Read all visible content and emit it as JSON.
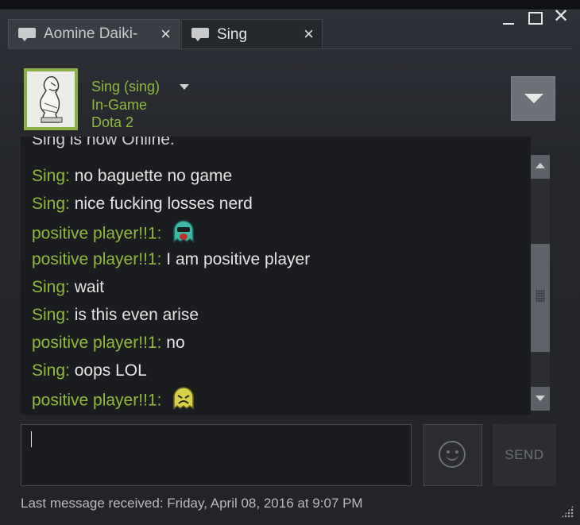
{
  "tabs": [
    {
      "label": "Aomine Daiki-",
      "close": "×"
    },
    {
      "label": "Sing",
      "close": "×"
    }
  ],
  "window_controls": {
    "close": "✕"
  },
  "friend": {
    "name": "Sing",
    "alias": "(sing)",
    "status": "In-Game",
    "game": "Dota 2"
  },
  "chat": {
    "clipped_line": "Sing is now Online.",
    "messages": [
      {
        "sender": "Sing",
        "colon": ":",
        "text": " no baguette no game"
      },
      {
        "sender": "Sing",
        "colon": ":",
        "text": " nice fucking losses nerd"
      },
      {
        "sender": "positive player!!1",
        "colon": ":",
        "text": "",
        "emote": "teal-ghost-emoticon"
      },
      {
        "sender": "positive player!!1",
        "colon": ":",
        "text": " I am positive player"
      },
      {
        "sender": "Sing",
        "colon": ":",
        "text": " wait"
      },
      {
        "sender": "Sing",
        "colon": ":",
        "text": " is this even arise"
      },
      {
        "sender": "positive player!!1",
        "colon": ":",
        "text": " no"
      },
      {
        "sender": "Sing",
        "colon": ":",
        "text": " oops LOL"
      },
      {
        "sender": "positive player!!1",
        "colon": ":",
        "text": "",
        "emote": "yellow-angry-emoticon"
      }
    ]
  },
  "composer": {
    "input_value": "",
    "send_label": "SEND"
  },
  "footer": {
    "last_message": "Last message received: Friday, April 08, 2016 at 9:07 PM"
  },
  "colors": {
    "accent_green": "#90ba3c",
    "background": "#222428",
    "text": "#e4e4e4"
  }
}
